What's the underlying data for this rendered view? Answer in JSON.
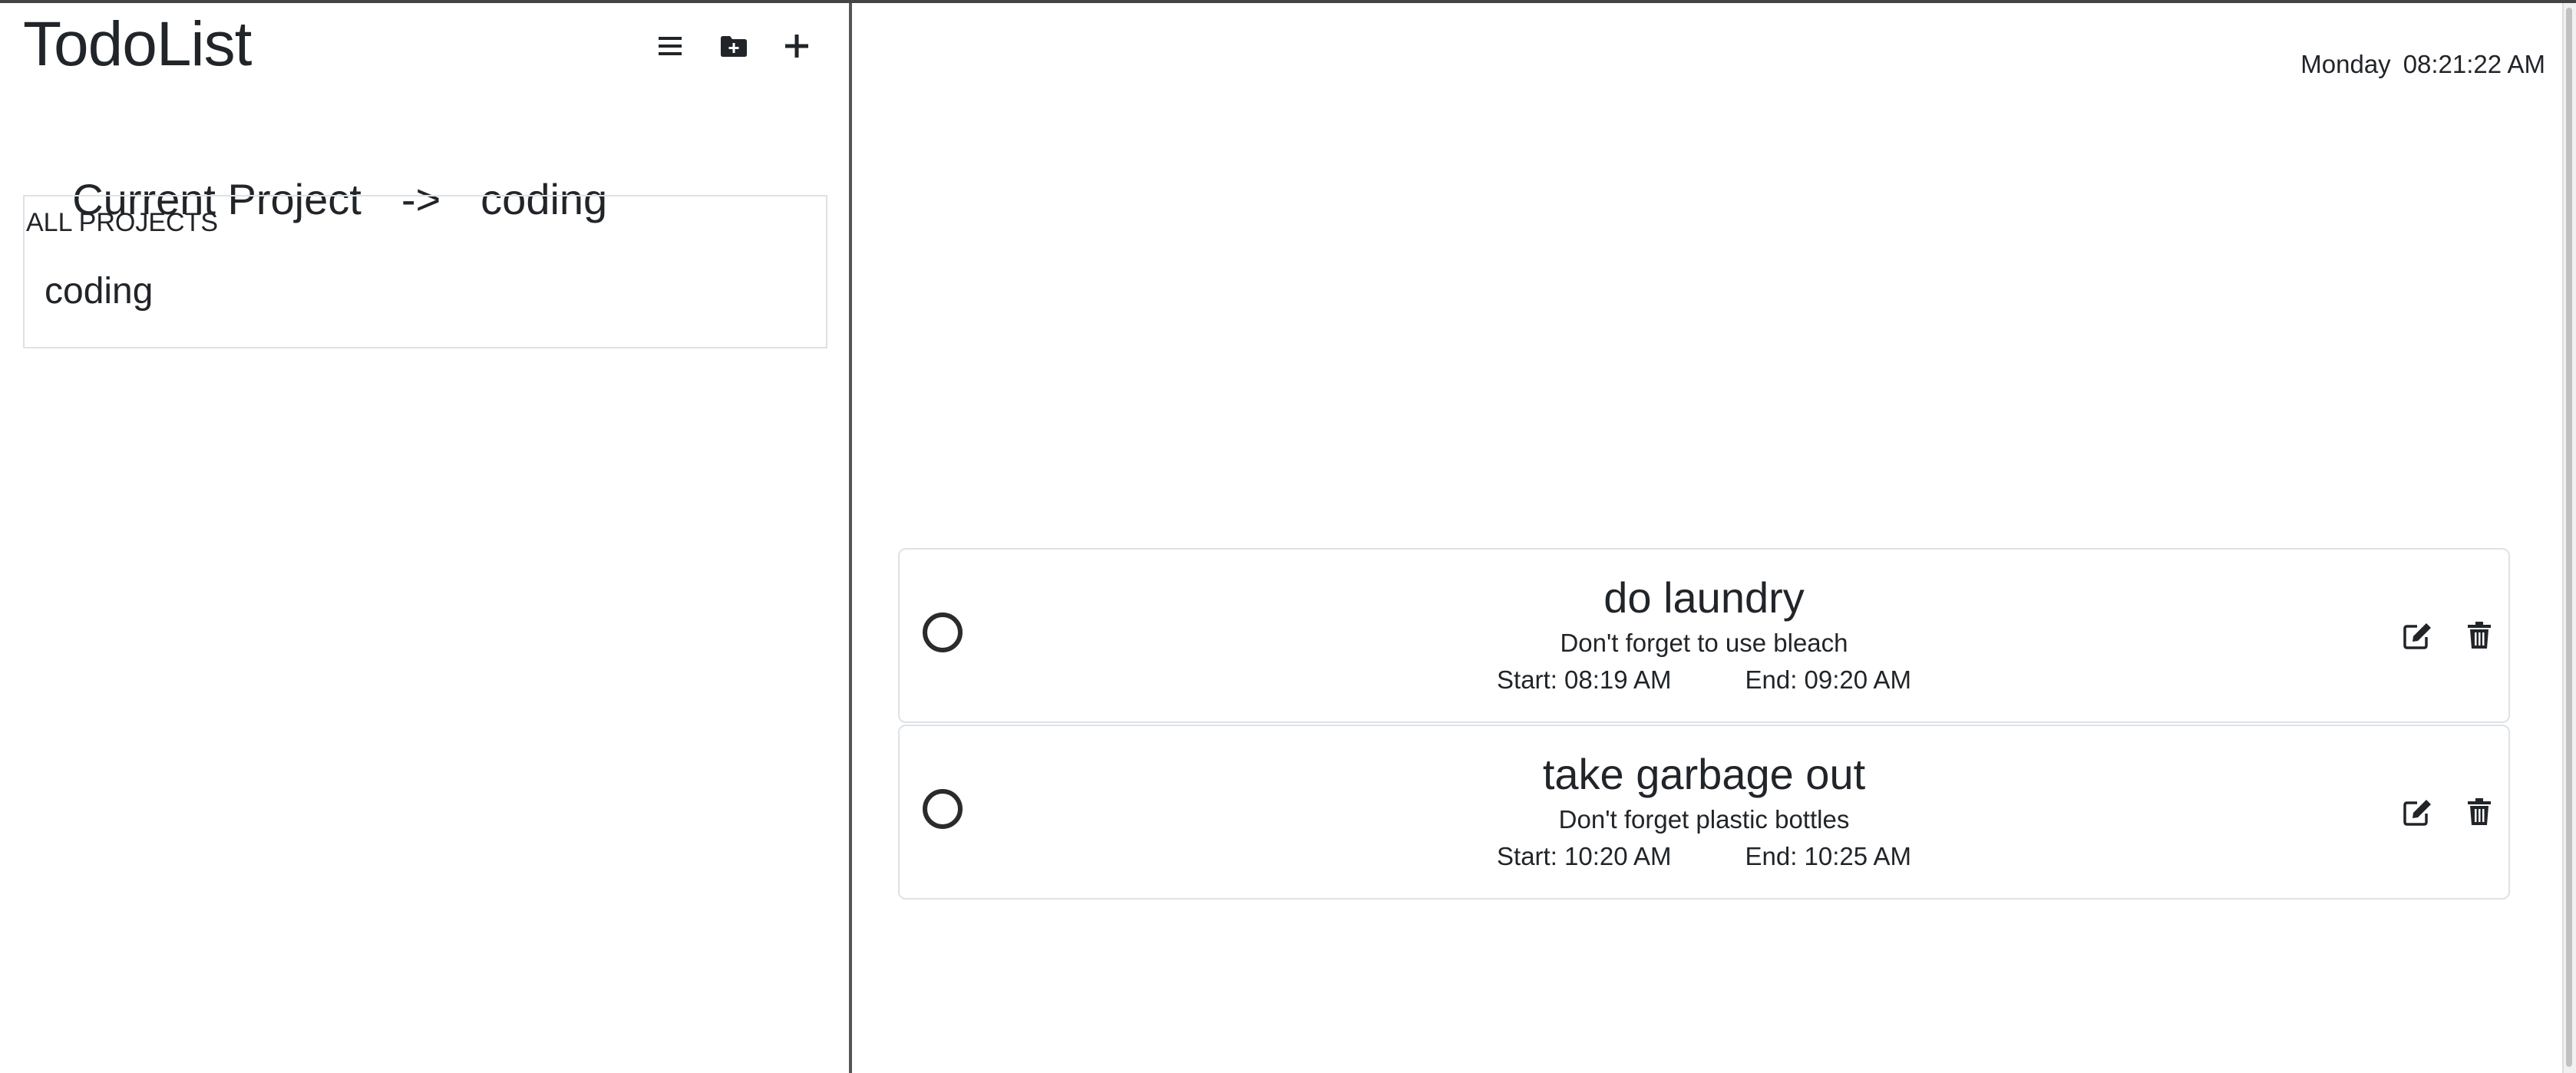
{
  "app": {
    "title": "TodoList"
  },
  "toolbar": {
    "icons": [
      "list-icon",
      "folder-plus-icon",
      "plus-icon"
    ]
  },
  "current_project": {
    "label": "Current Project",
    "arrow": "->",
    "name": "coding"
  },
  "projects": {
    "header": "ALL PROJECTS",
    "items": [
      {
        "name": "coding"
      }
    ]
  },
  "clock": {
    "day": "Monday",
    "time": "08:21:22 AM"
  },
  "tasks": [
    {
      "title": "do laundry",
      "description": "Don't forget to use bleach",
      "start": "Start: 08:19 AM",
      "end": "End: 09:20 AM",
      "completed": false
    },
    {
      "title": "take garbage out",
      "description": "Don't forget plastic bottles",
      "start": "Start: 10:20 AM",
      "end": "End: 10:25 AM",
      "completed": false
    }
  ],
  "colors": {
    "text": "#212529",
    "border": "#dee2e6",
    "divider": "#555555"
  }
}
